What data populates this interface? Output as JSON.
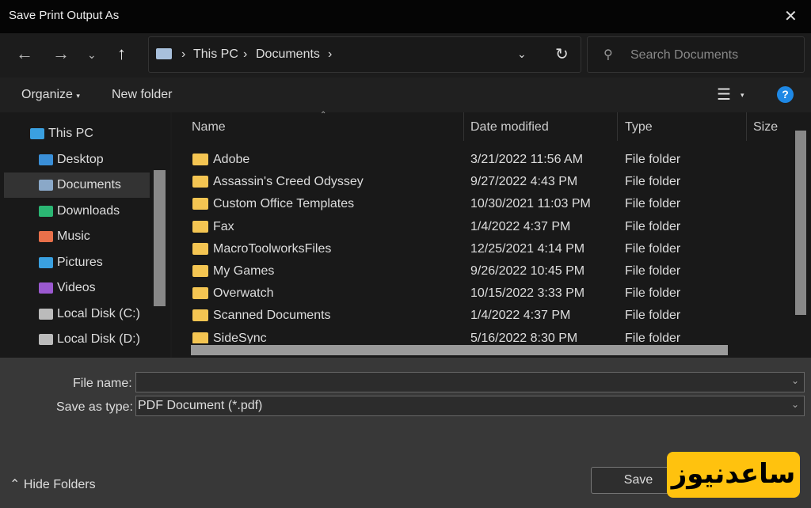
{
  "window": {
    "title": "Save Print Output As"
  },
  "address": {
    "crumbs": [
      "This PC",
      "Documents"
    ]
  },
  "search": {
    "placeholder": "Search Documents"
  },
  "toolbar": {
    "organize": "Organize",
    "new_folder": "New folder"
  },
  "sidebar": {
    "items": [
      {
        "label": "This PC",
        "color": "#3aa0e0"
      },
      {
        "label": "Desktop",
        "color": "#3a8fd8"
      },
      {
        "label": "Documents",
        "color": "#8aa8c8",
        "selected": true
      },
      {
        "label": "Downloads",
        "color": "#2bb673"
      },
      {
        "label": "Music",
        "color": "#e8704a"
      },
      {
        "label": "Pictures",
        "color": "#3aa0e0"
      },
      {
        "label": "Videos",
        "color": "#9b59d0"
      },
      {
        "label": "Local Disk (C:)",
        "color": "#bbbbbb"
      },
      {
        "label": "Local Disk (D:)",
        "color": "#bbbbbb"
      }
    ]
  },
  "columns": [
    "Name",
    "Date modified",
    "Type",
    "Size"
  ],
  "files": [
    {
      "name": "Adobe",
      "date": "3/21/2022 11:56 AM",
      "type": "File folder"
    },
    {
      "name": "Assassin's Creed Odyssey",
      "date": "9/27/2022 4:43 PM",
      "type": "File folder"
    },
    {
      "name": "Custom Office Templates",
      "date": "10/30/2021 11:03 PM",
      "type": "File folder"
    },
    {
      "name": "Fax",
      "date": "1/4/2022 4:37 PM",
      "type": "File folder"
    },
    {
      "name": "MacroToolworksFiles",
      "date": "12/25/2021 4:14 PM",
      "type": "File folder"
    },
    {
      "name": "My Games",
      "date": "9/26/2022 10:45 PM",
      "type": "File folder"
    },
    {
      "name": "Overwatch",
      "date": "10/15/2022 3:33 PM",
      "type": "File folder"
    },
    {
      "name": "Scanned Documents",
      "date": "1/4/2022 4:37 PM",
      "type": "File folder"
    },
    {
      "name": "SideSync",
      "date": "5/16/2022 8:30 PM",
      "type": "File folder"
    }
  ],
  "form": {
    "file_name_label": "File name:",
    "file_name_value": "",
    "type_label": "Save as type:",
    "type_value": "PDF Document (*.pdf)"
  },
  "footer": {
    "hide_folders": "Hide Folders",
    "save": "Save",
    "watermark": "ساعدنیوز"
  }
}
